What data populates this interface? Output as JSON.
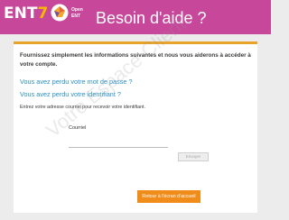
{
  "header": {
    "logo_ent": "ENT",
    "logo_ent_accent": "7",
    "open_ent_line1": "Open",
    "open_ent_line2": "ENT",
    "title": "Besoin d'aide ?"
  },
  "main": {
    "intro": "Fournissez simplement les informations suivantes et nous vous aiderons à accéder à votre compte.",
    "link_password": "Vous avez perdu votre mot de passe ?",
    "link_identifier": "Vous avez perdu votre identifiant ?",
    "help_text": "Entrez votre adresse courriel pour recevoir votre identifiant.",
    "email_label": "Courriel",
    "email_value": "",
    "send_label": "Envoyer",
    "home_label": "Retour à l'écran d'accueil"
  },
  "watermark": "Votre Espace Client",
  "colors": {
    "header": "#c7479a",
    "accent_orange": "#f08c1a",
    "link_blue": "#2a8fc7",
    "panel_border": "#e9a22a"
  }
}
